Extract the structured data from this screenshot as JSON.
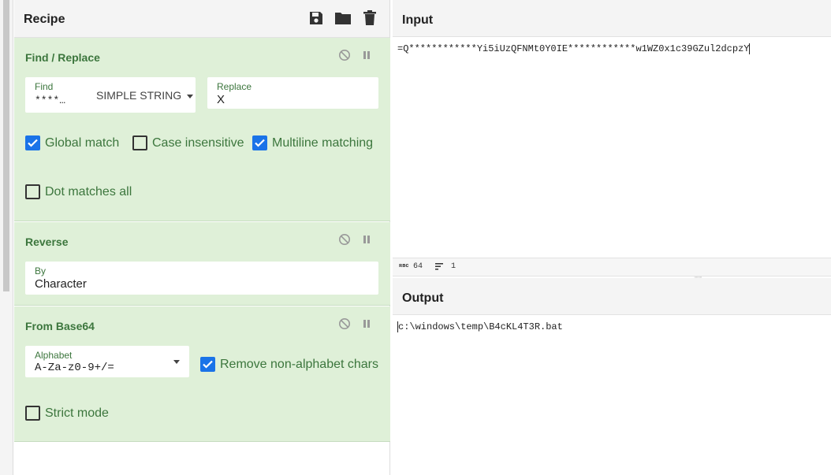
{
  "recipe": {
    "title": "Recipe",
    "icons": [
      "save-icon",
      "folder-icon",
      "trash-icon"
    ]
  },
  "find_replace": {
    "title": "Find / Replace",
    "find_label": "Find",
    "find_value": "****…",
    "find_mode": "SIMPLE STRING",
    "replace_label": "Replace",
    "replace_value": "X",
    "global_match": "Global match",
    "case_insensitive": "Case insensitive",
    "multiline": "Multiline matching",
    "dot_matches_all": "Dot matches all",
    "checked": {
      "global": true,
      "case": false,
      "multiline": true,
      "dotall": false
    }
  },
  "reverse": {
    "title": "Reverse",
    "by_label": "By",
    "by_value": "Character"
  },
  "from_base64": {
    "title": "From Base64",
    "alphabet_label": "Alphabet",
    "alphabet_value": "A-Za-z0-9+/=",
    "remove_non_alpha": "Remove non-alphabet chars",
    "strict_mode": "Strict mode",
    "checked": {
      "remove": true,
      "strict": false
    }
  },
  "input": {
    "title": "Input",
    "text": "=Q************Yi5iUzQFNMt0Y0IE************w1WZ0x1c39GZul2dcpzY",
    "length": "64",
    "lines": "1"
  },
  "output": {
    "title": "Output",
    "text": "c:\\windows\\temp\\B4cKL4T3R.bat"
  },
  "colors": {
    "accent": "#1a73e8",
    "op_bg": "#dff0d8",
    "op_text": "#3c763d"
  }
}
